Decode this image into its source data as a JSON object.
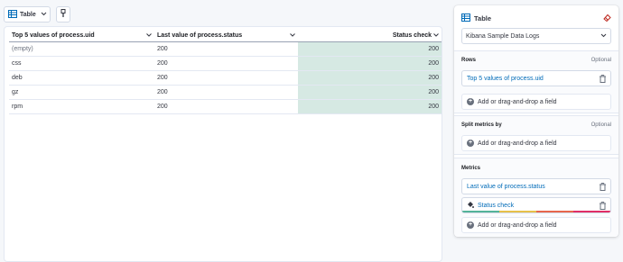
{
  "toolbar": {
    "vis_type_label": "Table"
  },
  "table": {
    "columns": [
      "Top 5 values of process.uid",
      "Last value of process.status",
      "Status check"
    ],
    "rows": [
      {
        "uid": "(empty)",
        "status": "200",
        "check": "200"
      },
      {
        "uid": "css",
        "status": "200",
        "check": "200"
      },
      {
        "uid": "deb",
        "status": "200",
        "check": "200"
      },
      {
        "uid": "gz",
        "status": "200",
        "check": "200"
      },
      {
        "uid": "rpm",
        "status": "200",
        "check": "200"
      }
    ]
  },
  "panel": {
    "title": "Table",
    "index_pattern": "Kibana Sample Data Logs",
    "rows_section": {
      "label": "Rows",
      "optional": "Optional",
      "dimension": "Top 5 values of process.uid",
      "add_label": "Add or drag-and-drop a field"
    },
    "split_section": {
      "label": "Split metrics by",
      "optional": "Optional",
      "add_label": "Add or drag-and-drop a field"
    },
    "metrics_section": {
      "label": "Metrics",
      "metric_1": "Last value of process.status",
      "metric_2": "Status check",
      "add_label": "Add or drag-and-drop a field"
    }
  },
  "colors": {
    "accent_link": "#006bb8",
    "status_cell_bg": "#d6e9e3",
    "palette": [
      "#54b399",
      "#e7c14a",
      "#e7664c",
      "#e02e66"
    ]
  },
  "icons": {
    "vis_type": "table-grid-icon",
    "dropdown": "chevron-down-icon",
    "palette": "paintbrush-icon",
    "sort": "chevron-down-icon",
    "erase": "eraser-icon",
    "trash": "trash-icon",
    "add": "plus-circle-icon",
    "color_palette": "paint-bucket-icon"
  }
}
